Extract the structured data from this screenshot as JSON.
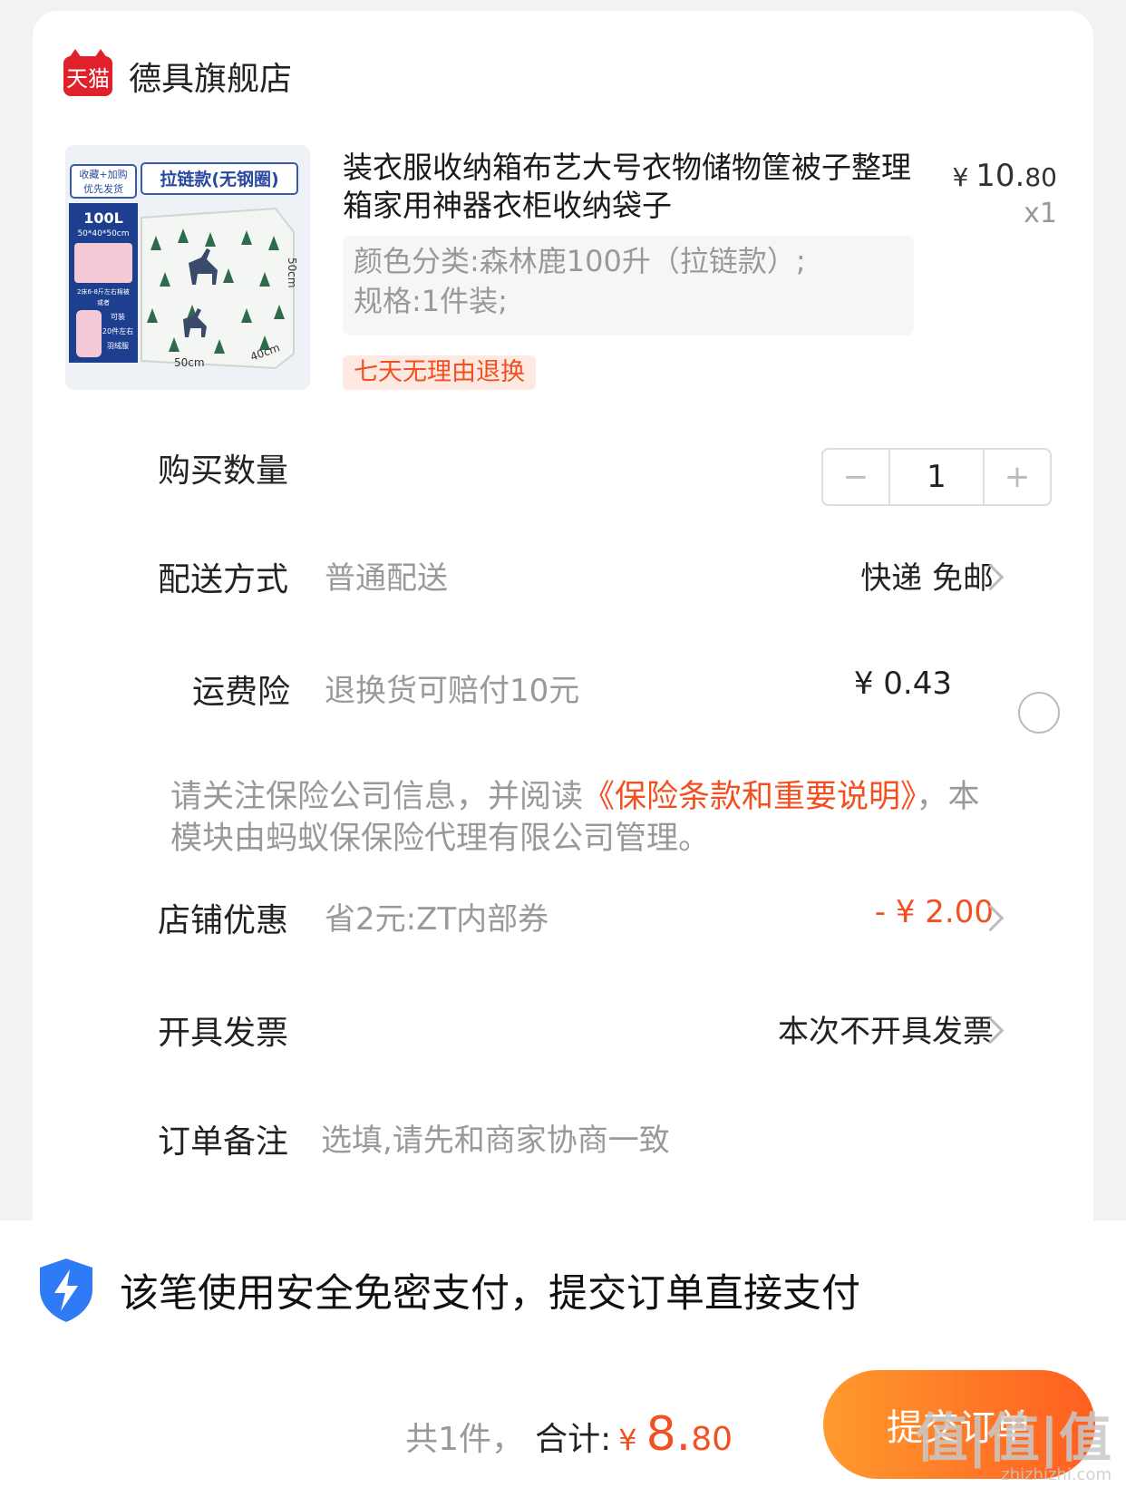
{
  "store": {
    "logo_text": "天猫",
    "name": "德具旗舰店"
  },
  "product": {
    "title": "装衣服收纳箱布艺大号衣物储物筐被子整理箱家用神器衣柜收纳袋子",
    "price_currency": "¥",
    "price_int": "10.",
    "price_cents": "80",
    "quantity_label": "x1",
    "spec_line1": "颜色分类:森林鹿100升（拉链款）;",
    "spec_line2": "规格:1件装;",
    "badge": "七天无理由退换",
    "thumb": {
      "tag1": "收藏+加购",
      "tag1b": "优先发货",
      "headline": "拉链款(无钢圈)",
      "capacity": "100L",
      "dims": "50*40*50cm",
      "note1": "2床6-8斤左右棉被",
      "note2": "或者",
      "note3": "可装",
      "note4": "20件左右",
      "note5": "羽绒服",
      "width": "50cm",
      "depth": "40cm",
      "height": "50cm"
    }
  },
  "quantity": {
    "label": "购买数量",
    "minus": "−",
    "value": "1",
    "plus": "+"
  },
  "delivery": {
    "label": "配送方式",
    "desc": "普通配送",
    "value": "快递 免邮"
  },
  "insurance": {
    "label": "运费险",
    "desc": "退换货可赔付10元",
    "price": "¥ 0.43"
  },
  "notice": {
    "part1": "请关注保险公司信息，并阅读",
    "link": "《保险条款和重要说明》",
    "part2": "，本模块由蚂蚁保保险代理有限公司管理。"
  },
  "discount": {
    "label": "店铺优惠",
    "desc": "省2元:ZT内部券",
    "value": "- ¥ 2.00"
  },
  "invoice": {
    "label": "开具发票",
    "value": "本次不开具发票"
  },
  "remark": {
    "label": "订单备注",
    "placeholder": "选填,请先和商家协商一致"
  },
  "footer": {
    "secure_text": "该笔使用安全免密支付，提交订单直接支付",
    "count_text": "共1件，",
    "total_label": "合计:",
    "currency": "¥",
    "total_int": "8.",
    "total_cents": "80",
    "submit_label": "提交订单"
  },
  "watermark": {
    "main": "值|值|值",
    "sub": "zhizhizhi.com"
  },
  "colors": {
    "accent": "#f25020",
    "tmall_red": "#e0202a",
    "shield_blue": "#2f7bf5"
  }
}
